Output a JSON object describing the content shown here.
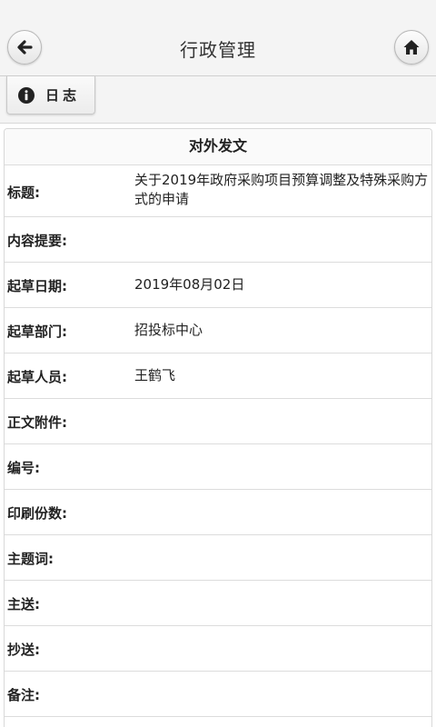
{
  "header": {
    "title": "行政管理",
    "back_icon": "arrow-left-icon",
    "home_icon": "home-icon"
  },
  "toolbar": {
    "log_label": "日志",
    "log_icon": "info-icon"
  },
  "section": {
    "title": "对外发文"
  },
  "fields": [
    {
      "label": "标题:",
      "value": "关于2019年政府采购项目预算调整及特殊采购方式的申请"
    },
    {
      "label": "内容提要:",
      "value": ""
    },
    {
      "label": "起草日期:",
      "value": "2019年08月02日"
    },
    {
      "label": "起草部门:",
      "value": "招投标中心"
    },
    {
      "label": "起草人员:",
      "value": "王鹤飞"
    },
    {
      "label": "正文附件:",
      "value": ""
    },
    {
      "label": "编号:",
      "value": ""
    },
    {
      "label": "印刷份数:",
      "value": ""
    },
    {
      "label": "主题词:",
      "value": ""
    },
    {
      "label": "主送:",
      "value": ""
    },
    {
      "label": "抄送:",
      "value": ""
    },
    {
      "label": "备注:",
      "value": ""
    }
  ]
}
